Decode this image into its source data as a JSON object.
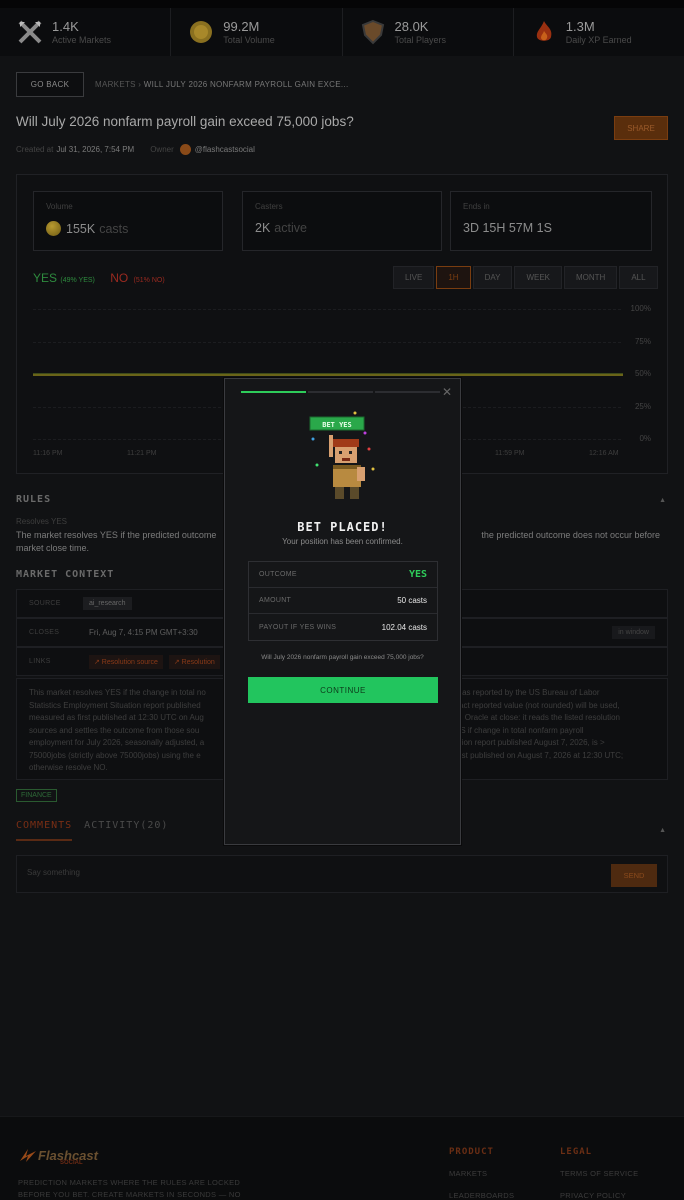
{
  "stats": [
    {
      "value": "1.4K",
      "label": "Active Markets",
      "icon": "crossed-swords-icon"
    },
    {
      "value": "99.2M",
      "label": "Total Volume",
      "icon": "coin-icon"
    },
    {
      "value": "28.0K",
      "label": "Total Players",
      "icon": "shield-icon"
    },
    {
      "value": "1.3M",
      "label": "Daily XP Earned",
      "icon": "flame-icon"
    }
  ],
  "header": {
    "go_back": "GO BACK",
    "breadcrumb_root": "MARKETS ›",
    "breadcrumb_current": "WILL JULY 2026 NONFARM PAYROLL GAIN EXCE...",
    "title": "Will July 2026 nonfarm payroll gain exceed 75,000 jobs?",
    "share": "SHARE",
    "created_label": "Created at",
    "created_value": "Jul 31, 2026, 7:54 PM",
    "owner_label": "Owner",
    "owner_value": "@flashcastsocial"
  },
  "market_card": {
    "volume_label": "Volume",
    "volume_value": "155K",
    "volume_unit": "casts",
    "casters_label": "Casters",
    "casters_value": "2K",
    "casters_unit": "active",
    "ends_label": "Ends in",
    "ends_value": "3D 15H 57M 1S",
    "yes_label": "YES",
    "yes_pct": "(49% YES)",
    "no_label": "NO",
    "no_pct": "(51% NO)",
    "ranges": [
      "LIVE",
      "1H",
      "DAY",
      "WEEK",
      "MONTH",
      "ALL"
    ],
    "active_range": "1H"
  },
  "chart_data": {
    "type": "line",
    "ylim": [
      0,
      100
    ],
    "y_ticks": [
      "100%",
      "75%",
      "50%",
      "25%",
      "0%"
    ],
    "x_ticks": [
      "11:16 PM",
      "11:21 PM",
      "11:59 PM",
      "12:16 AM"
    ],
    "series": [
      {
        "name": "YES",
        "color": "#6a6418",
        "values": [
          50,
          50,
          50,
          50
        ]
      }
    ]
  },
  "rules": {
    "heading": "RULES",
    "sub": "Resolves YES",
    "text_left": "The market resolves YES if the predicted outcome",
    "text_right": "the predicted outcome does not occur before",
    "text_line2": "market close time."
  },
  "context": {
    "heading": "MARKET CONTEXT",
    "source_label": "SOURCE",
    "source_value": "ai_research",
    "closes_label": "CLOSES",
    "closes_value": "Fri, Aug 7, 4:15 PM GMT+3:30",
    "in_window": "in window",
    "links_label": "LINKS",
    "link1": "↗ Resolution source",
    "link2": "↗ Resolution",
    "desc_lines": [
      "This market resolves YES if the change in total no",
      "Statistics Employment Situation report published",
      "measured as first published at 12:30 UTC on Aug",
      "sources and settles the outcome from those sou",
      "employment for July 2026, seasonally adjusted, a",
      "75000jobs (strictly above 75000jobs) using the e",
      "otherwise resolve NO."
    ],
    "desc_lines_right": [
      "), as reported by the US Bureau of Labor",
      "xact reported value (not rounded) will be used,",
      "AI Oracle at close: it reads the listed resolution",
      "ES if change in total nonfarm payroll",
      "ation report published August 7, 2026, is >",
      "first published on August 7, 2026 at 12:30 UTC;",
      ""
    ],
    "tag": "FINANCE"
  },
  "comments": {
    "tab_comments": "COMMENTS",
    "tab_activity": "ACTIVITY(20)",
    "placeholder": "Say something",
    "send": "SEND"
  },
  "footer": {
    "logo": "Flashcast",
    "logo_sub": "SOCIAL",
    "tagline_1": "PREDICTION MARKETS WHERE THE RULES ARE LOCKED",
    "tagline_2": "BEFORE YOU BET. CREATE MARKETS IN SECONDS — NO",
    "product_head": "PRODUCT",
    "product_links": [
      "MARKETS",
      "LEADERBOARDS"
    ],
    "legal_head": "LEGAL",
    "legal_links": [
      "TERMS OF SERVICE",
      "PRIVACY POLICY"
    ]
  },
  "modal": {
    "badge": "BET YES",
    "title": "BET PLACED!",
    "subtitle": "Your position has been confirmed.",
    "outcome_label": "OUTCOME",
    "outcome_value": "YES",
    "amount_label": "AMOUNT",
    "amount_value": "50 casts",
    "payout_label": "PAYOUT IF YES WINS",
    "payout_value": "102.04 casts",
    "question": "Will July 2026 nonfarm payroll gain exceed 75,000 jobs?",
    "continue": "CONTINUE",
    "colors": {
      "accent": "#22c55e",
      "brand": "#7a3d10"
    }
  }
}
